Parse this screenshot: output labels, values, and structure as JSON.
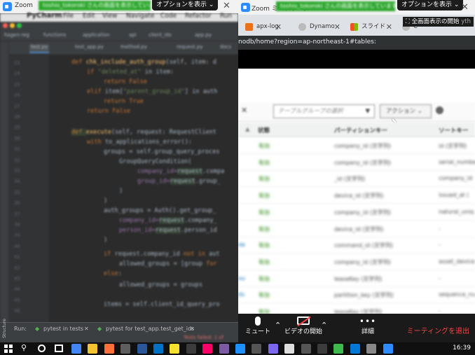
{
  "left_window": {
    "title": "Zoom",
    "share_badge": "toshio_tokoroki さんの画面を表示しています",
    "options_label": "オプションを表示",
    "close": "✕",
    "menu": [
      "PyCharm",
      "File",
      "Edit",
      "View",
      "Navigate",
      "Code",
      "Refactor",
      "Run"
    ],
    "breadcrumbs": [
      "hagen-reg",
      "functions",
      "application",
      "api",
      "client_ids",
      "app.py"
    ],
    "file_tabs": [
      "test.py",
      "test_app.py",
      "method.py",
      "request.py",
      "docs"
    ],
    "line_numbers": [
      "23",
      "24",
      "25",
      "26",
      "27",
      "28",
      "29",
      "30",
      "31",
      "32",
      "33",
      "34",
      "35",
      "36",
      "37",
      "38",
      "39",
      "40",
      "41",
      "42",
      "43",
      "44",
      "45",
      "46"
    ],
    "code": {
      "l1_def": "def ",
      "l1_fn": "chk_include_auth_group",
      "l1_rest": "(self, item: d",
      "l2a": "if ",
      "l2s": "\"deleted_at\"",
      "l2b": " in item:",
      "l3a": "return ",
      "l3b": "False",
      "l4a": "elif ",
      "l4b": "item[",
      "l4s": "\"parent_group_id\"",
      "l4c": "] in auth",
      "l5a": "return ",
      "l5b": "True",
      "l6a": "return ",
      "l6b": "False",
      "l7a": "def ",
      "l7f": "execute",
      "l7b": "(self, request: RequestClient",
      "l8a": "with ",
      "l8b": "to_applications_error():",
      "l9": "groups = self.group_query_proces",
      "l10": "GroupQueryCondition(",
      "l11a": "company_id=",
      "l11b": "request",
      "l11c": ".compa",
      "l12a": "group_id=",
      "l12b": "request",
      "l12c": ".group_",
      "l13": ")",
      "l14": ")",
      "l15": "auth_groups = Auth().get_group_",
      "l16a": "company_id=",
      "l16b": "request",
      "l16c": ".company_",
      "l17a": "person_id=",
      "l17b": "request",
      "l17c": ".person_id",
      "l18": ")",
      "l19a": "if ",
      "l19b": "request.company_id ",
      "l19c": "not in ",
      "l19d": "aut",
      "l20a": "allowed_groups = [group ",
      "l20b": "for",
      "l21a": "else",
      "l21b": ":",
      "l22": "allowed_groups = groups",
      "l23a": "items = self.client_id_query_pro"
    },
    "run_label": "Run:",
    "run_tabs": [
      "pytest in tests",
      "pytest for test_app.test_get_ids"
    ],
    "tests_status": "Tests failed: 1 of",
    "structure_label": "Structure"
  },
  "right_window": {
    "title": "Zoom ミーティング",
    "share_badge": "toshio_tokoroki さんの画面を表示しています",
    "options_label": "オプションを表示",
    "close": "✕",
    "tabs": [
      {
        "label": "apx-log",
        "close": "✕"
      },
      {
        "label": "Dynamo",
        "close": "✕"
      },
      {
        "label": "スライド",
        "close": "✕"
      },
      {
        "label": "C",
        "close": ""
      }
    ],
    "fullscreen_label": "全画面表示の開始",
    "fullscreen_suffix": "yth",
    "url_text": "nodb/home?region=ap-northeast-1#tables:",
    "toolbar_close": "✕",
    "table_group_placeholder": "テーブルグループの選択",
    "actions_label": "アクション",
    "headers": [
      "状態",
      "パーティションキー",
      "ソートキー"
    ],
    "rows": [
      {
        "status": "有効",
        "partition": "company_id (文字列)",
        "sort": "id (文字列)",
        "lead": ""
      },
      {
        "status": "有効",
        "partition": "company_id (文字列)",
        "sort": "serial_numbe",
        "lead": ""
      },
      {
        "status": "有効",
        "partition": "_id (文字列)",
        "sort": "company_id",
        "lead": ""
      },
      {
        "status": "有効",
        "partition": "device_id (文字列)",
        "sort": "issued_at (",
        "lead": ""
      },
      {
        "status": "有効",
        "partition": "company_id (文字列)",
        "sort": "natural_uniq",
        "lead": ""
      },
      {
        "status": "有効",
        "partition": "device_id (文字列)",
        "sort": "-",
        "lead": ""
      },
      {
        "status": "有効",
        "partition": "command_id (文字列)",
        "sort": "-",
        "lead": "de"
      },
      {
        "status": "有効",
        "partition": "company_id (文字列)",
        "sort": "asset_device",
        "lead": ""
      },
      {
        "status": "有効",
        "partition": "leaseKey (文字列)",
        "sort": "-",
        "lead": "ou"
      },
      {
        "status": "有効",
        "partition": "partition_key (文字列)",
        "sort": "sequence_nu",
        "lead": "ds"
      },
      {
        "status": "有効",
        "partition": "leaseKey (文字列)",
        "sort": "-",
        "lead": ""
      }
    ]
  },
  "zoom_controls": {
    "mute_label": "ミュート",
    "video_label": "ビデオの開始",
    "details_label": "詳細",
    "leave_label": "ミーティングを退出"
  },
  "taskbar": {
    "clock": "16:39"
  }
}
